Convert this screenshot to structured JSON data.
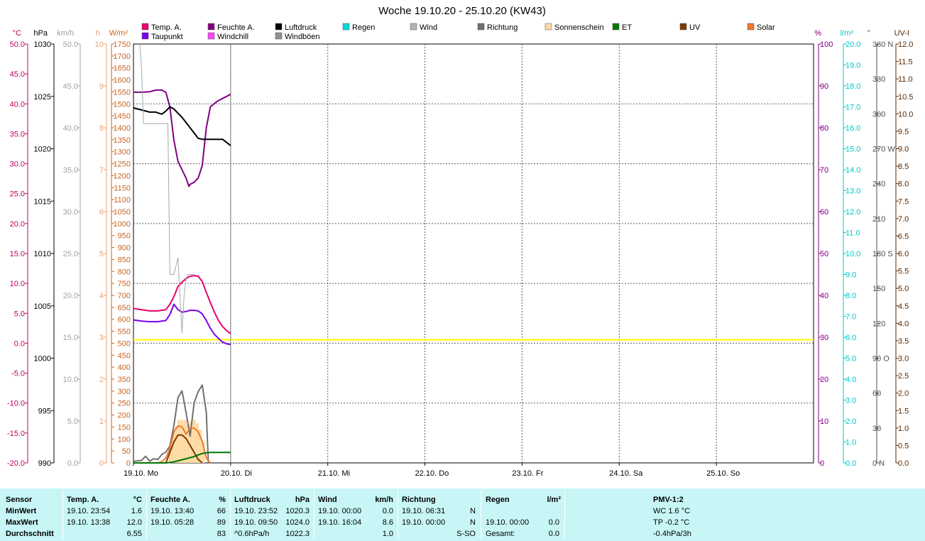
{
  "title": "Woche 19.10.20 - 25.10.20 (KW43)",
  "legend": [
    {
      "label": "Temp. A.",
      "color": "#e8006c",
      "row": 0,
      "col": 0
    },
    {
      "label": "Taupunkt",
      "color": "#7a00e8",
      "row": 1,
      "col": 0
    },
    {
      "label": "Feuchte A.",
      "color": "#800080",
      "row": 0,
      "col": 1
    },
    {
      "label": "Windchill",
      "color": "#ff44ff",
      "row": 1,
      "col": 1
    },
    {
      "label": "Luftdruck",
      "color": "#000000",
      "row": 0,
      "col": 2
    },
    {
      "label": "Windböen",
      "color": "#909090",
      "row": 1,
      "col": 2
    },
    {
      "label": "Regen",
      "color": "#00d8d8",
      "row": 0,
      "col": 3
    },
    {
      "label": "Wind",
      "color": "#b4b4b4",
      "row": 0,
      "col": 4
    },
    {
      "label": "Richtung",
      "color": "#707070",
      "row": 0,
      "col": 5
    },
    {
      "label": "Sonnenschein",
      "color": "#ffd9a0",
      "row": 0,
      "col": 6
    },
    {
      "label": "ET",
      "color": "#007800",
      "row": 0,
      "col": 7
    },
    {
      "label": "UV",
      "color": "#7a3a00",
      "row": 0,
      "col": 8
    },
    {
      "label": "Solar",
      "color": "#f07828",
      "row": 0,
      "col": 9
    }
  ],
  "axis_units": {
    "temp": "°C",
    "pressure": "hPa",
    "wind": "km/h",
    "sun": "h",
    "solar": "W/m²",
    "humidity": "%",
    "rain": "l/m²",
    "direction": "°",
    "uv": "UV-I"
  },
  "axes": {
    "temp": {
      "color": "#c00060",
      "labels": [
        "50.0",
        "45.0",
        "40.0",
        "35.0",
        "30.0",
        "25.0",
        "20.0",
        "15.0",
        "10.0",
        "5.0",
        "0.0",
        "-5.0",
        "-10.0",
        "-15.0",
        "-20.0"
      ]
    },
    "pressure": {
      "color": "#000000",
      "labels": [
        "1030",
        "1025",
        "1020",
        "1015",
        "1010",
        "1005",
        "1000",
        "995",
        "990"
      ]
    },
    "wind": {
      "color": "#a0a0a0",
      "labels": [
        "50.0",
        "45.0",
        "40.0",
        "35.0",
        "30.0",
        "25.0",
        "20.0",
        "15.0",
        "10.0",
        "5.0",
        "0.0"
      ]
    },
    "sun": {
      "color": "#e8a070",
      "labels": [
        "10",
        "9",
        "8",
        "7",
        "6",
        "5",
        "4",
        "3",
        "2",
        "1",
        "0"
      ]
    },
    "solar": {
      "color": "#c86420",
      "labels": [
        "1750",
        "1700",
        "1650",
        "1600",
        "1550",
        "1500",
        "1450",
        "1400",
        "1350",
        "1300",
        "1250",
        "1200",
        "1150",
        "1100",
        "1050",
        "1000",
        "950",
        "900",
        "850",
        "800",
        "750",
        "700",
        "650",
        "600",
        "550",
        "500",
        "450",
        "400",
        "350",
        "300",
        "250",
        "200",
        "150",
        "100",
        "50",
        "0"
      ]
    },
    "humidity": {
      "color": "#800080",
      "labels": [
        "100",
        "90",
        "80",
        "70",
        "60",
        "50",
        "40",
        "30",
        "20",
        "10",
        "0"
      ]
    },
    "rain": {
      "color": "#00c8c8",
      "labels": [
        "20.0",
        "19.0",
        "18.0",
        "17.0",
        "16.0",
        "15.0",
        "14.0",
        "13.0",
        "12.0",
        "11.0",
        "10.0",
        "9.0",
        "8.0",
        "7.0",
        "6.0",
        "5.0",
        "4.0",
        "3.0",
        "2.0",
        "1.0",
        "0.0"
      ]
    },
    "direction": {
      "color": "#505050",
      "labels": [
        "360 N",
        "330",
        "300",
        "270 W",
        "240",
        "210",
        "180 S",
        "150",
        "120",
        "90 O",
        "60",
        "30",
        "0 N"
      ]
    },
    "uv": {
      "color": "#5a2800",
      "labels": [
        "12.0",
        "11.5",
        "11.0",
        "10.5",
        "10.0",
        "9.5",
        "9.0",
        "8.5",
        "8.0",
        "7.5",
        "7.0",
        "6.5",
        "6.0",
        "5.5",
        "5.0",
        "4.5",
        "4.0",
        "3.5",
        "3.0",
        "2.5",
        "2.0",
        "1.5",
        "1.0",
        "0.5",
        "0.0"
      ]
    }
  },
  "x_labels": [
    "19.10. Mo",
    "20.10. Di",
    "21.10. Mi",
    "22.10. Do",
    "23.10. Fr",
    "24.10. Sa",
    "25.10. So"
  ],
  "chart_data": {
    "type": "line",
    "x_unit": "hours since 19.10. 00:00",
    "x_range": [
      0,
      168
    ],
    "series": [
      {
        "name": "Temp. A.",
        "axis": "temp",
        "color": "#e8006c",
        "width": 2,
        "x": [
          0,
          2,
          4,
          6,
          8,
          9,
          10,
          11,
          12,
          13,
          14,
          15,
          16,
          17,
          18,
          19,
          20,
          21,
          22,
          23,
          24
        ],
        "y": [
          5.8,
          5.6,
          5.4,
          5.4,
          5.6,
          6.5,
          7.8,
          9.5,
          10.2,
          10.8,
          11.2,
          11.3,
          11.2,
          10.3,
          8.5,
          6.8,
          5.2,
          3.8,
          2.8,
          2.1,
          1.6
        ]
      },
      {
        "name": "Taupunkt",
        "axis": "temp",
        "color": "#7a00e8",
        "width": 2,
        "x": [
          0,
          2,
          4,
          6,
          8,
          9,
          10,
          11,
          12,
          13,
          14,
          15,
          16,
          17,
          18,
          19,
          20,
          21,
          22,
          23,
          24
        ],
        "y": [
          3.9,
          3.7,
          3.6,
          3.6,
          3.8,
          4.8,
          6.5,
          5.6,
          5.2,
          5.3,
          5.5,
          5.5,
          5.4,
          4.9,
          3.8,
          2.5,
          1.5,
          0.8,
          0.2,
          -0.1,
          -0.2
        ]
      },
      {
        "name": "Feuchte A.",
        "axis": "humidity",
        "color": "#800080",
        "width": 2,
        "x": [
          0,
          2,
          4,
          5.5,
          7,
          8,
          9,
          10,
          11,
          12,
          13,
          13.7,
          14,
          15,
          16,
          17,
          18,
          19,
          20,
          21,
          22,
          23,
          24
        ],
        "y": [
          88.5,
          88.5,
          88.6,
          89,
          89,
          88.5,
          85,
          77,
          72,
          70,
          68,
          66,
          66.5,
          67,
          68,
          71,
          80,
          85,
          85.8,
          86.5,
          87,
          87.5,
          88
        ]
      },
      {
        "name": "Luftdruck",
        "axis": "pressure",
        "color": "#000000",
        "width": 2,
        "x": [
          0,
          2,
          4,
          5.5,
          7,
          8,
          9,
          10,
          11,
          12,
          13,
          14,
          15,
          16,
          17,
          18,
          19,
          20,
          21,
          22,
          23,
          24
        ],
        "y": [
          1023.9,
          1023.7,
          1023.5,
          1023.5,
          1023.3,
          1023.6,
          1024.0,
          1023.8,
          1023.4,
          1023.0,
          1022.5,
          1022.0,
          1021.5,
          1021.0,
          1020.9,
          1020.9,
          1020.9,
          1020.9,
          1020.9,
          1020.9,
          1020.6,
          1020.3
        ]
      },
      {
        "name": "Windböen",
        "axis": "wind",
        "color": "#a8a8a8",
        "width": 1,
        "x": [
          1.6,
          2,
          2.5,
          5.5,
          7,
          8,
          8.5,
          9,
          9.5,
          10,
          10.5,
          11,
          12,
          12.5,
          13,
          13.5,
          14,
          14.5,
          15
        ],
        "y": [
          50.0,
          47,
          40.5,
          40.5,
          40.5,
          40.5,
          40.5,
          22.5,
          22.5,
          22.5,
          23.5,
          24.5,
          15.5,
          20,
          22,
          22.5,
          22.5,
          22.5,
          22.5
        ]
      },
      {
        "name": "Wind",
        "axis": "wind",
        "color": "#707070",
        "width": 2,
        "x": [
          0,
          2,
          3,
          4,
          5,
          6,
          7,
          8,
          9,
          10,
          11,
          12,
          13,
          14,
          15,
          16,
          17,
          18,
          18.5
        ],
        "y": [
          0.2,
          0.3,
          0.8,
          0.2,
          0.5,
          0.4,
          1.0,
          1.3,
          2.0,
          4.5,
          7.8,
          8.6,
          6.0,
          3.2,
          7.2,
          8.5,
          9.3,
          6.0,
          0
        ]
      },
      {
        "name": "Solar",
        "axis": "solar",
        "color": "#f07828",
        "width": 2,
        "x": [
          0,
          6,
          7,
          8,
          9,
          10,
          11,
          12,
          13,
          14,
          15,
          16,
          17,
          18,
          19
        ],
        "y": [
          0,
          0,
          5,
          20,
          60,
          130,
          155,
          150,
          120,
          145,
          145,
          130,
          90,
          20,
          0
        ]
      },
      {
        "name": "UV",
        "axis": "uv",
        "color": "#7a3a00",
        "width": 2,
        "x": [
          0,
          8,
          9,
          10,
          11,
          12,
          13,
          14,
          15,
          16,
          17
        ],
        "y": [
          0,
          0,
          0.3,
          0.6,
          0.8,
          0.8,
          0.7,
          0.5,
          0.3,
          0.1,
          0
        ]
      },
      {
        "name": "ET",
        "axis": "rain",
        "color": "#007800",
        "width": 2,
        "x": [
          0,
          8,
          9,
          10,
          11,
          12,
          13,
          14,
          15,
          16,
          17,
          18,
          19,
          20,
          21,
          22,
          23,
          24
        ],
        "y": [
          0,
          0,
          0.02,
          0.05,
          0.1,
          0.15,
          0.2,
          0.25,
          0.3,
          0.38,
          0.45,
          0.48,
          0.5,
          0.5,
          0.5,
          0.5,
          0.5,
          0.5
        ]
      }
    ],
    "sunshine_bars": {
      "axis": "solar",
      "color": "#ffd9a0",
      "x": [
        9,
        9.75,
        10.5,
        11.25,
        12,
        12.75,
        13.5,
        14.25,
        15,
        15.75,
        16.5,
        17.25
      ],
      "y": [
        60,
        120,
        150,
        180,
        180,
        180,
        160,
        175,
        180,
        165,
        140,
        90
      ]
    },
    "reference_line": {
      "axis": "humidity",
      "value": 29.4,
      "color": "#ffff00"
    },
    "cursor_hour": 24
  },
  "stats": {
    "columns": [
      {
        "header": "Sensor",
        "unit": "",
        "rows": [
          "MinWert",
          "MaxWert",
          "Durchschnitt"
        ]
      },
      {
        "header": "Temp. A.",
        "unit": "°C",
        "times": [
          "19.10.  23:54",
          "19.10.  13:38",
          ""
        ],
        "values": [
          "1.6",
          "12.0",
          "6.55"
        ]
      },
      {
        "header": "Feuchte A.",
        "unit": "%",
        "times": [
          "19.10.  13:40",
          "19.10.  05:28",
          ""
        ],
        "values": [
          "66",
          "89",
          "83"
        ]
      },
      {
        "header": "Luftdruck",
        "unit": "hPa",
        "times": [
          "19.10.  23:52",
          "19.10.  09:50",
          "^0.6hPa/h"
        ],
        "values": [
          "1020.3",
          "1024.0",
          "1022.3"
        ]
      },
      {
        "header": "Wind",
        "unit": "km/h",
        "times": [
          "19.10.  00:00",
          "19.10.  16:04",
          ""
        ],
        "values": [
          "0.0",
          "8.6",
          "1.0"
        ]
      },
      {
        "header": "Richtung",
        "unit": "",
        "times": [
          "19.10.  06:31",
          "19.10.  00:00",
          ""
        ],
        "values": [
          "N",
          "N",
          "S-SO"
        ]
      },
      {
        "header": "Regen",
        "unit": "l/m²",
        "times": [
          "",
          "19.10.  00:00",
          "Gesamt:"
        ],
        "values": [
          "",
          "0.0",
          "0.0"
        ]
      }
    ],
    "pmv": {
      "header": "PMV-1:2",
      "lines": [
        "WC 1.6 °C",
        "TP -0.2 °C",
        "-0.4hPa/3h"
      ]
    }
  }
}
